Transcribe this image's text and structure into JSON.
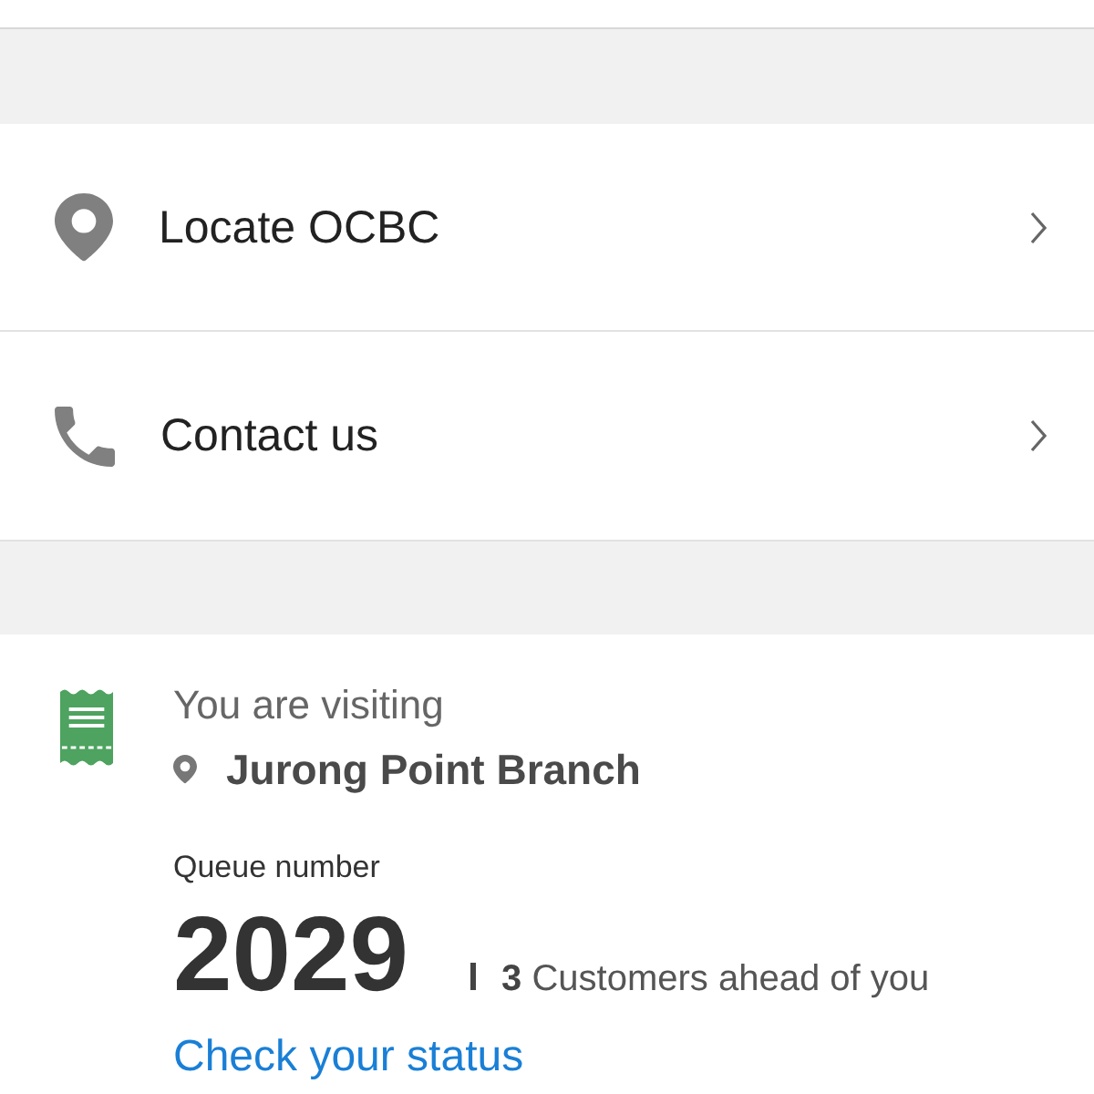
{
  "menu_items": [
    {
      "kind": "location",
      "label": "Locate OCBC"
    },
    {
      "kind": "phone",
      "label": "Contact us"
    }
  ],
  "visit_card": {
    "heading": "You are visiting",
    "branch": "Jurong Point Branch",
    "queue_label": "Queue number",
    "queue_number": "2029",
    "ahead_text": "**3** Customers ahead of you",
    "status_link": "Check your status"
  }
}
